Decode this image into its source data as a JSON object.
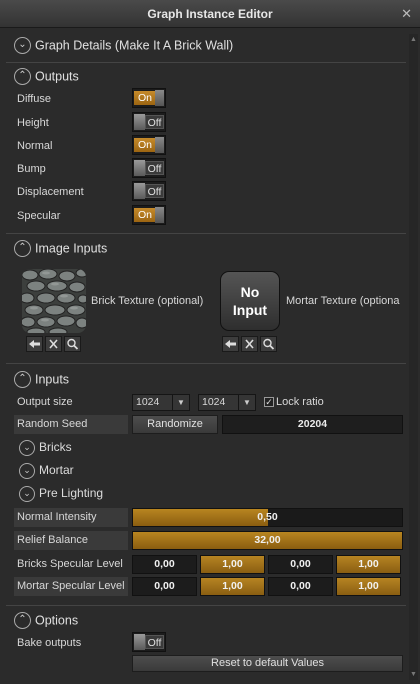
{
  "window": {
    "title": "Graph Instance Editor",
    "close": "✕"
  },
  "details": {
    "label": "Graph Details (Make It A Brick Wall)"
  },
  "outputs": {
    "label": "Outputs",
    "items": [
      {
        "label": "Diffuse",
        "state": "On"
      },
      {
        "label": "Height",
        "state": "Off"
      },
      {
        "label": "Normal",
        "state": "On"
      },
      {
        "label": "Bump",
        "state": "Off"
      },
      {
        "label": "Displacement",
        "state": "Off"
      },
      {
        "label": "Specular",
        "state": "On"
      }
    ]
  },
  "image_inputs": {
    "label": "Image Inputs",
    "brick": {
      "label": "Brick Texture (optional)"
    },
    "mortar": {
      "label": "Mortar Texture (optiona",
      "placeholder_line1": "No",
      "placeholder_line2": "Input"
    }
  },
  "inputs": {
    "label": "Inputs",
    "output_size": {
      "label": "Output size",
      "width": "1024",
      "height": "1024",
      "lock_label": "Lock ratio",
      "lock_checked": true
    },
    "random_seed": {
      "label": "Random Seed",
      "button": "Randomize",
      "value": "20204"
    },
    "groups": [
      "Bricks",
      "Mortar",
      "Pre Lighting"
    ],
    "normal_intensity": {
      "label": "Normal Intensity",
      "value": "0,50",
      "fraction": 0.5
    },
    "relief_balance": {
      "label": "Relief Balance",
      "value": "32,00",
      "fraction": 1.0
    },
    "bricks_specular": {
      "label": "Bricks Specular Level",
      "values": [
        "0,00",
        "1,00",
        "0,00",
        "1,00"
      ]
    },
    "mortar_specular": {
      "label": "Mortar Specular Level",
      "values": [
        "0,00",
        "1,00",
        "0,00",
        "1,00"
      ]
    }
  },
  "options": {
    "label": "Options",
    "bake": {
      "label": "Bake outputs",
      "state": "Off"
    },
    "reset_label": "Reset to default Values"
  },
  "colors": {
    "accent": "#b07a1e",
    "bg": "#2b2b2b",
    "field": "#1c1c1c"
  }
}
